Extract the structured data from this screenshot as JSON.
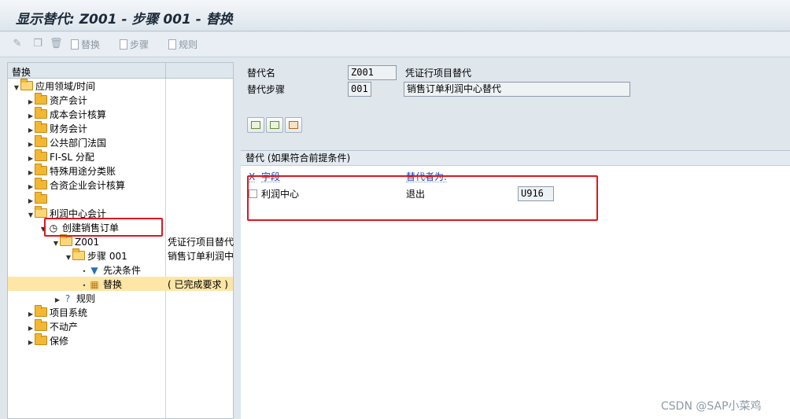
{
  "window": {
    "title": "显示替代: Z001 - 步骤 001 - 替换"
  },
  "toolbar": {
    "icons": [
      "edit-icon",
      "copy-icon",
      "delete-icon"
    ],
    "buttons": [
      "替换",
      "步骤",
      "规则"
    ]
  },
  "tree": {
    "header": "替换",
    "nodes": [
      {
        "label": "应用领域/时间",
        "desc": ""
      },
      {
        "label": "资产会计",
        "desc": ""
      },
      {
        "label": "成本会计核算",
        "desc": ""
      },
      {
        "label": "财务会计",
        "desc": ""
      },
      {
        "label": "公共部门法国",
        "desc": ""
      },
      {
        "label": "FI-SL 分配",
        "desc": ""
      },
      {
        "label": "特殊用途分类账",
        "desc": ""
      },
      {
        "label": "合资企业会计核算",
        "desc": ""
      },
      {
        "label": "",
        "desc": ""
      },
      {
        "label": "利润中心会计",
        "desc": ""
      },
      {
        "label": "创建销售订单",
        "desc": ""
      },
      {
        "label": "Z001",
        "desc": "凭证行项目替代"
      },
      {
        "label": "步骤 001",
        "desc": "销售订单利润中"
      },
      {
        "label": "先决条件",
        "desc": ""
      },
      {
        "label": "替换",
        "desc": "( 已完成要求 )"
      },
      {
        "label": "规则",
        "desc": ""
      },
      {
        "label": "项目系统",
        "desc": ""
      },
      {
        "label": "不动产",
        "desc": ""
      },
      {
        "label": "保修",
        "desc": ""
      }
    ]
  },
  "detail": {
    "sub_name_label": "替代名",
    "sub_name_value": "Z001",
    "sub_name_desc": "凭证行项目替代",
    "step_label": "替代步骤",
    "step_value": "001",
    "step_desc": "销售订单利润中心替代"
  },
  "group": {
    "title": "替代 (如果符合前提条件)",
    "col_x": "X",
    "col_field": "字段",
    "col_value": "替代者为.",
    "row": {
      "field": "利润中心",
      "method": "退出",
      "value": "U916"
    }
  },
  "watermark": "CSDN @SAP小菜鸡",
  "colors": {
    "highlight": "#fde6a6",
    "annotation": "#e0161e",
    "folder": "#f2b733"
  }
}
